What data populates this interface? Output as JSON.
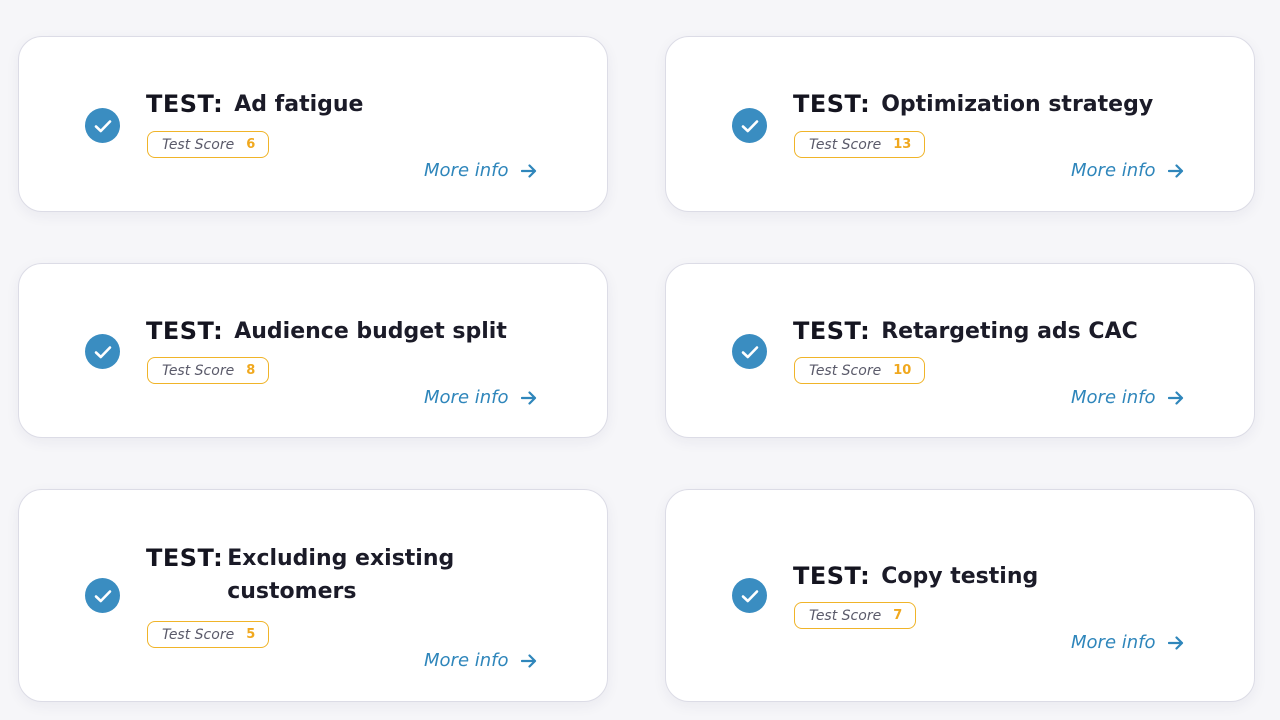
{
  "tests": [
    {
      "prefix": "TEST:",
      "title": "Ad fatigue",
      "score_label": "Test Score",
      "score": "6",
      "more_info": "More info"
    },
    {
      "prefix": "TEST:",
      "title": "Optimization strategy",
      "score_label": "Test Score",
      "score": "13",
      "more_info": "More info"
    },
    {
      "prefix": "TEST:",
      "title": "Audience budget split",
      "score_label": "Test Score",
      "score": "8",
      "more_info": "More info"
    },
    {
      "prefix": "TEST:",
      "title": "Retargeting ads CAC",
      "score_label": "Test Score",
      "score": "10",
      "more_info": "More info"
    },
    {
      "prefix": "TEST:",
      "title": "Excluding existing customers",
      "score_label": "Test Score",
      "score": "5",
      "more_info": "More info"
    },
    {
      "prefix": "TEST:",
      "title": "Copy testing",
      "score_label": "Test Score",
      "score": "7",
      "more_info": "More info"
    }
  ],
  "icons": {
    "status": "check-circle-icon",
    "more_info": "arrow-right-icon"
  },
  "colors": {
    "check_blue": "#3a8dc1",
    "link_blue": "#2f86bb",
    "score_orange": "#f0b429"
  }
}
